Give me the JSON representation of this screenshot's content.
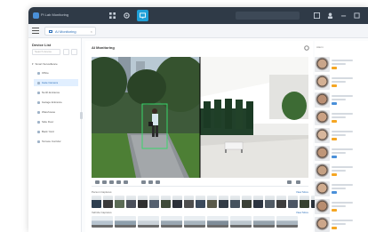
{
  "app": {
    "title": "Pi Lab Monitoring"
  },
  "tabs": [
    {
      "label": "AI Monitoring"
    }
  ],
  "device_list": {
    "title": "Device List",
    "search_placeholder": "Search device",
    "root": "Smart Surveillance",
    "items": [
      {
        "label": "Office"
      },
      {
        "label": "Gate Camera"
      },
      {
        "label": "North Entrance"
      },
      {
        "label": "Garage Entrance"
      },
      {
        "label": "Warehouse"
      },
      {
        "label": "Side Door"
      },
      {
        "label": "Back Yard"
      },
      {
        "label": "Terrace Corridor"
      }
    ],
    "selected_index": 1
  },
  "main": {
    "title": "AI Monitoring",
    "person_strip_label": "Person Captures",
    "person_strip_more": "View More",
    "vehicle_strip_label": "Vehicle Captures",
    "vehicle_strip_more": "View More"
  },
  "right_column": {
    "title": "Alarm",
    "cards": [
      {
        "badge": "orange"
      },
      {
        "badge": "orange"
      },
      {
        "badge": "blue"
      },
      {
        "badge": "orange"
      },
      {
        "badge": "orange"
      },
      {
        "badge": "blue"
      },
      {
        "badge": "orange"
      },
      {
        "badge": "blue"
      },
      {
        "badge": "orange"
      },
      {
        "badge": "orange"
      }
    ]
  },
  "colors": {
    "titlebar": "#2f3a47",
    "accent": "#1fa0d8",
    "selected_bg": "#e1efff",
    "link": "#2c6fb8"
  }
}
